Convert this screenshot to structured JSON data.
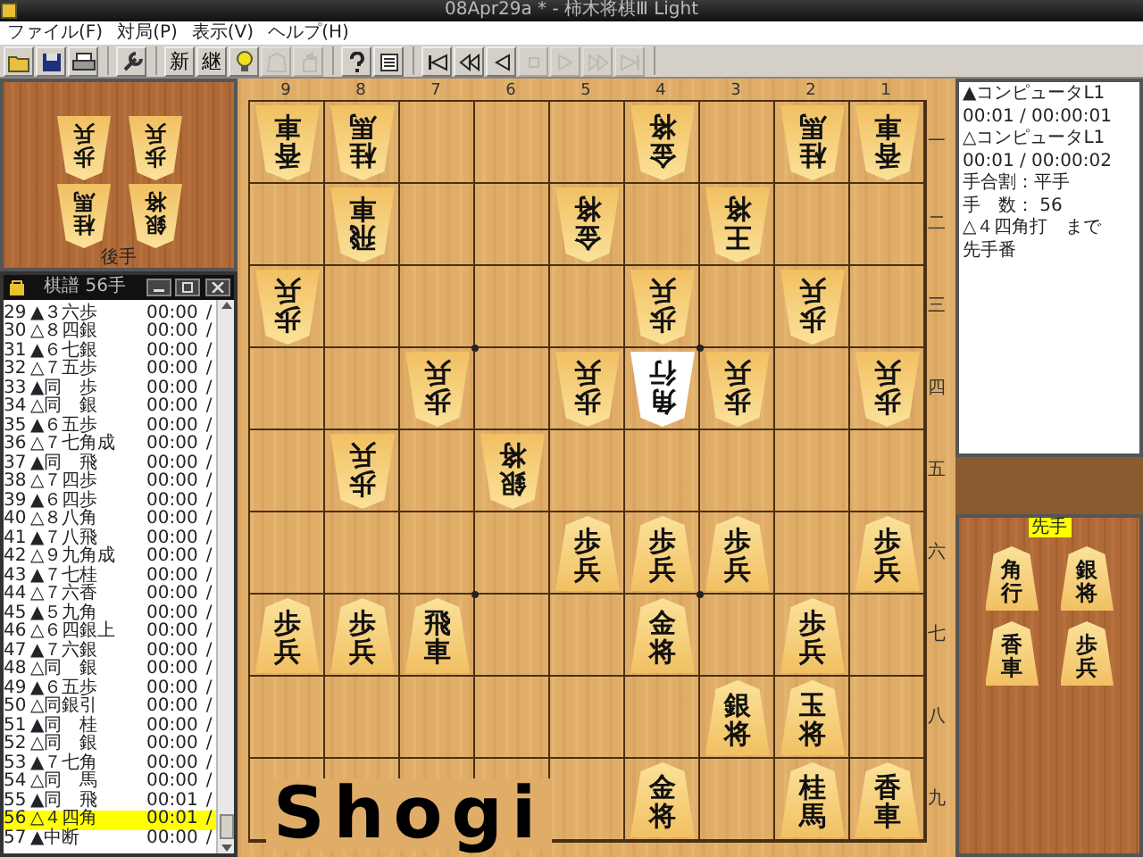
{
  "window": {
    "title": "08Apr29a * - 柿木将棋Ⅲ Light"
  },
  "menu": [
    "ファイル(F)",
    "対局(P)",
    "表示(V)",
    "ヘルプ(H)"
  ],
  "toolbar": {
    "groups": [
      [
        {
          "disabled": false
        },
        {
          "disabled": false
        },
        {
          "disabled": false
        }
      ],
      [
        {
          "disabled": false
        }
      ],
      [
        {
          "label": "新",
          "disabled": false
        },
        {
          "label": "継",
          "disabled": false
        },
        {
          "disabled": false
        },
        {
          "disabled": true
        },
        {
          "disabled": true
        }
      ],
      [
        {
          "disabled": false
        },
        {
          "disabled": false
        }
      ],
      [
        {
          "disabled": false
        },
        {
          "disabled": false
        },
        {
          "disabled": false
        },
        {
          "disabled": true
        },
        {
          "disabled": true
        },
        {
          "disabled": true
        },
        {
          "disabled": true
        }
      ]
    ]
  },
  "gote_hand": {
    "label": "後手",
    "pieces": [
      "歩兵",
      "歩兵",
      "桂馬",
      "銀将"
    ]
  },
  "kifu": {
    "title": "棋譜 56手",
    "rows": [
      {
        "no": "29",
        "move": "▲３六歩",
        "time": "00:00",
        "sep": "/",
        "selected": false
      },
      {
        "no": "30",
        "move": "△８四銀",
        "time": "00:00",
        "sep": "/",
        "selected": false
      },
      {
        "no": "31",
        "move": "▲６七銀",
        "time": "00:00",
        "sep": "/",
        "selected": false
      },
      {
        "no": "32",
        "move": "△７五歩",
        "time": "00:00",
        "sep": "/",
        "selected": false
      },
      {
        "no": "33",
        "move": "▲同　歩",
        "time": "00:00",
        "sep": "/",
        "selected": false
      },
      {
        "no": "34",
        "move": "△同　銀",
        "time": "00:00",
        "sep": "/",
        "selected": false
      },
      {
        "no": "35",
        "move": "▲６五歩",
        "time": "00:00",
        "sep": "/",
        "selected": false
      },
      {
        "no": "36",
        "move": "△７七角成",
        "time": "00:00",
        "sep": "/",
        "selected": false
      },
      {
        "no": "37",
        "move": "▲同　飛",
        "time": "00:00",
        "sep": "/",
        "selected": false
      },
      {
        "no": "38",
        "move": "△７四歩",
        "time": "00:00",
        "sep": "/",
        "selected": false
      },
      {
        "no": "39",
        "move": "▲６四歩",
        "time": "00:00",
        "sep": "/",
        "selected": false
      },
      {
        "no": "40",
        "move": "△８八角",
        "time": "00:00",
        "sep": "/",
        "selected": false
      },
      {
        "no": "41",
        "move": "▲７八飛",
        "time": "00:00",
        "sep": "/",
        "selected": false
      },
      {
        "no": "42",
        "move": "△９九角成",
        "time": "00:00",
        "sep": "/",
        "selected": false
      },
      {
        "no": "43",
        "move": "▲７七桂",
        "time": "00:00",
        "sep": "/",
        "selected": false
      },
      {
        "no": "44",
        "move": "△７六香",
        "time": "00:00",
        "sep": "/",
        "selected": false
      },
      {
        "no": "45",
        "move": "▲５九角",
        "time": "00:00",
        "sep": "/",
        "selected": false
      },
      {
        "no": "46",
        "move": "△６四銀上",
        "time": "00:00",
        "sep": "/",
        "selected": false
      },
      {
        "no": "47",
        "move": "▲７六銀",
        "time": "00:00",
        "sep": "/",
        "selected": false
      },
      {
        "no": "48",
        "move": "△同　銀",
        "time": "00:00",
        "sep": "/",
        "selected": false
      },
      {
        "no": "49",
        "move": "▲６五歩",
        "time": "00:00",
        "sep": "/",
        "selected": false
      },
      {
        "no": "50",
        "move": "△同銀引",
        "time": "00:00",
        "sep": "/",
        "selected": false
      },
      {
        "no": "51",
        "move": "▲同　桂",
        "time": "00:00",
        "sep": "/",
        "selected": false
      },
      {
        "no": "52",
        "move": "△同　銀",
        "time": "00:00",
        "sep": "/",
        "selected": false
      },
      {
        "no": "53",
        "move": "▲７七角",
        "time": "00:00",
        "sep": "/",
        "selected": false
      },
      {
        "no": "54",
        "move": "△同　馬",
        "time": "00:00",
        "sep": "/",
        "selected": false
      },
      {
        "no": "55",
        "move": "▲同　飛",
        "time": "00:01",
        "sep": "/",
        "selected": false
      },
      {
        "no": "56",
        "move": "△４四角",
        "time": "00:01",
        "sep": "/",
        "selected": true
      },
      {
        "no": "57",
        "move": "▲中断",
        "time": "00:00",
        "sep": "/",
        "selected": false
      }
    ]
  },
  "board": {
    "files": [
      "9",
      "8",
      "7",
      "6",
      "5",
      "4",
      "3",
      "2",
      "1"
    ],
    "ranks": [
      "一",
      "二",
      "三",
      "四",
      "五",
      "六",
      "七",
      "八",
      "九"
    ],
    "rows": [
      [
        {
          "piece": "香車",
          "gote": true,
          "highlighted": false
        },
        {
          "piece": "桂馬",
          "gote": true,
          "highlighted": false
        },
        null,
        null,
        null,
        {
          "piece": "金将",
          "gote": true,
          "highlighted": false
        },
        null,
        {
          "piece": "桂馬",
          "gote": true,
          "highlighted": false
        },
        {
          "piece": "香車",
          "gote": true,
          "highlighted": false
        }
      ],
      [
        null,
        {
          "piece": "飛車",
          "gote": true,
          "highlighted": false
        },
        null,
        null,
        {
          "piece": "金将",
          "gote": true,
          "highlighted": false
        },
        null,
        {
          "piece": "王将",
          "gote": true,
          "highlighted": false
        },
        null,
        null
      ],
      [
        {
          "piece": "歩兵",
          "gote": true,
          "highlighted": false
        },
        null,
        null,
        null,
        null,
        {
          "piece": "歩兵",
          "gote": true,
          "highlighted": false
        },
        null,
        {
          "piece": "歩兵",
          "gote": true,
          "highlighted": false
        },
        null
      ],
      [
        null,
        null,
        {
          "piece": "歩兵",
          "gote": true,
          "highlighted": false
        },
        null,
        {
          "piece": "歩兵",
          "gote": true,
          "highlighted": false
        },
        {
          "piece": "角行",
          "gote": true,
          "highlighted": true
        },
        {
          "piece": "歩兵",
          "gote": true,
          "highlighted": false
        },
        null,
        {
          "piece": "歩兵",
          "gote": true,
          "highlighted": false
        }
      ],
      [
        null,
        {
          "piece": "歩兵",
          "gote": true,
          "highlighted": false
        },
        null,
        {
          "piece": "銀将",
          "gote": true,
          "highlighted": false
        },
        null,
        null,
        null,
        null,
        null
      ],
      [
        null,
        null,
        null,
        null,
        {
          "piece": "歩兵",
          "gote": false,
          "highlighted": false
        },
        {
          "piece": "歩兵",
          "gote": false,
          "highlighted": false
        },
        {
          "piece": "歩兵",
          "gote": false,
          "highlighted": false
        },
        null,
        {
          "piece": "歩兵",
          "gote": false,
          "highlighted": false
        }
      ],
      [
        {
          "piece": "歩兵",
          "gote": false,
          "highlighted": false
        },
        {
          "piece": "歩兵",
          "gote": false,
          "highlighted": false
        },
        {
          "piece": "飛車",
          "gote": false,
          "highlighted": false
        },
        null,
        null,
        {
          "piece": "金将",
          "gote": false,
          "highlighted": false
        },
        null,
        {
          "piece": "歩兵",
          "gote": false,
          "highlighted": false
        },
        null
      ],
      [
        null,
        null,
        null,
        null,
        null,
        null,
        {
          "piece": "銀将",
          "gote": false,
          "highlighted": false
        },
        {
          "piece": "玉将",
          "gote": false,
          "highlighted": false
        },
        null
      ],
      [
        null,
        null,
        null,
        null,
        null,
        {
          "piece": "金将",
          "gote": false,
          "highlighted": false
        },
        null,
        {
          "piece": "桂馬",
          "gote": false,
          "highlighted": false
        },
        {
          "piece": "香車",
          "gote": false,
          "highlighted": false
        }
      ]
    ],
    "logo": "Shogi"
  },
  "info": [
    "▲コンピュータL1",
    "00:01 / 00:00:01",
    "△コンピュータL1",
    "00:01 / 00:00:02",
    "手合割：平手",
    "手　数：  56",
    "△４四角打　まで",
    "先手番"
  ],
  "sente_hand": {
    "label": "先手",
    "pieces": [
      "角行",
      "銀将",
      "香車",
      "歩兵"
    ]
  }
}
